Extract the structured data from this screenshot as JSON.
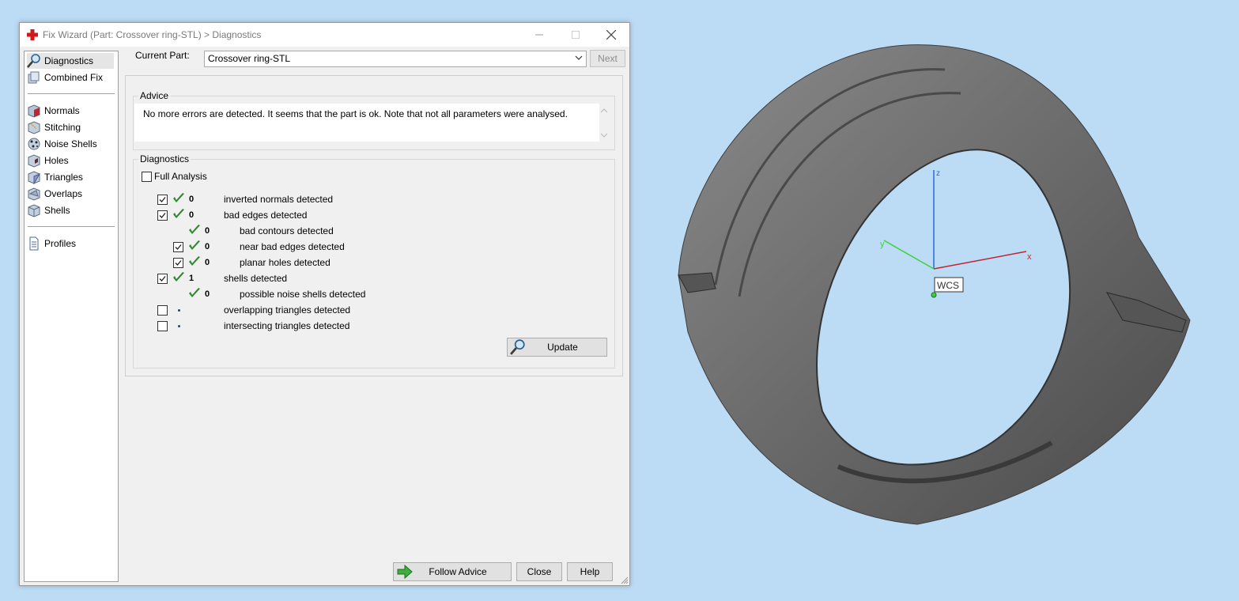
{
  "window": {
    "title": "Fix Wizard (Part: Crossover ring-STL) > Diagnostics",
    "minimize_icon": "minimize-icon",
    "maximize_icon": "maximize-icon",
    "close_icon": "close-icon"
  },
  "sidebar": {
    "items": [
      {
        "label": "Diagnostics",
        "icon": "magnifier-icon",
        "selected": true
      },
      {
        "label": "Combined Fix",
        "icon": "cube-stack-icon"
      },
      {
        "label": "Normals",
        "icon": "cube-red-face-icon"
      },
      {
        "label": "Stitching",
        "icon": "cube-stitch-icon"
      },
      {
        "label": "Noise Shells",
        "icon": "noise-shells-icon"
      },
      {
        "label": "Holes",
        "icon": "cube-hole-icon"
      },
      {
        "label": "Triangles",
        "icon": "cube-triangle-icon"
      },
      {
        "label": "Overlaps",
        "icon": "cube-overlap-icon"
      },
      {
        "label": "Shells",
        "icon": "cube-shell-icon"
      },
      {
        "label": "Profiles",
        "icon": "document-icon"
      }
    ]
  },
  "current_part": {
    "label": "Current Part:",
    "value": "Crossover ring-STL",
    "next_label": "Next"
  },
  "advice": {
    "title": "Advice",
    "text": "No more errors are detected. It seems that the part is ok. Note that not all parameters were analysed."
  },
  "diagnostics": {
    "title": "Diagnostics",
    "full_analysis_label": "Full Analysis",
    "rows": [
      {
        "checkbox": true,
        "checked": true,
        "status": "ok",
        "count": "0",
        "label": "inverted normals detected",
        "indent": 0
      },
      {
        "checkbox": true,
        "checked": true,
        "status": "ok",
        "count": "0",
        "label": "bad edges detected",
        "indent": 0
      },
      {
        "checkbox": false,
        "status": "ok",
        "count": "0",
        "label": "bad contours detected",
        "indent": 1
      },
      {
        "checkbox": true,
        "checked": true,
        "status": "ok",
        "count": "0",
        "label": "near bad edges detected",
        "indent": 1
      },
      {
        "checkbox": true,
        "checked": true,
        "status": "ok",
        "count": "0",
        "label": "planar holes detected",
        "indent": 1
      },
      {
        "checkbox": true,
        "checked": true,
        "status": "ok",
        "count": "1",
        "label": "shells detected",
        "indent": 0
      },
      {
        "checkbox": false,
        "status": "ok",
        "count": "0",
        "label": "possible noise shells detected",
        "indent": 1
      },
      {
        "checkbox": true,
        "checked": false,
        "status": "pending",
        "count": "",
        "label": "overlapping triangles detected",
        "indent": 0
      },
      {
        "checkbox": true,
        "checked": false,
        "status": "pending",
        "count": "",
        "label": "intersecting triangles detected",
        "indent": 0
      }
    ],
    "update_label": "Update"
  },
  "footer": {
    "follow_advice_label": "Follow Advice",
    "close_label": "Close",
    "help_label": "Help"
  },
  "viewport": {
    "wcs_label": "WCS",
    "axis_x": "x",
    "axis_y": "y",
    "axis_z": "z",
    "background": "#bcdcf6"
  }
}
